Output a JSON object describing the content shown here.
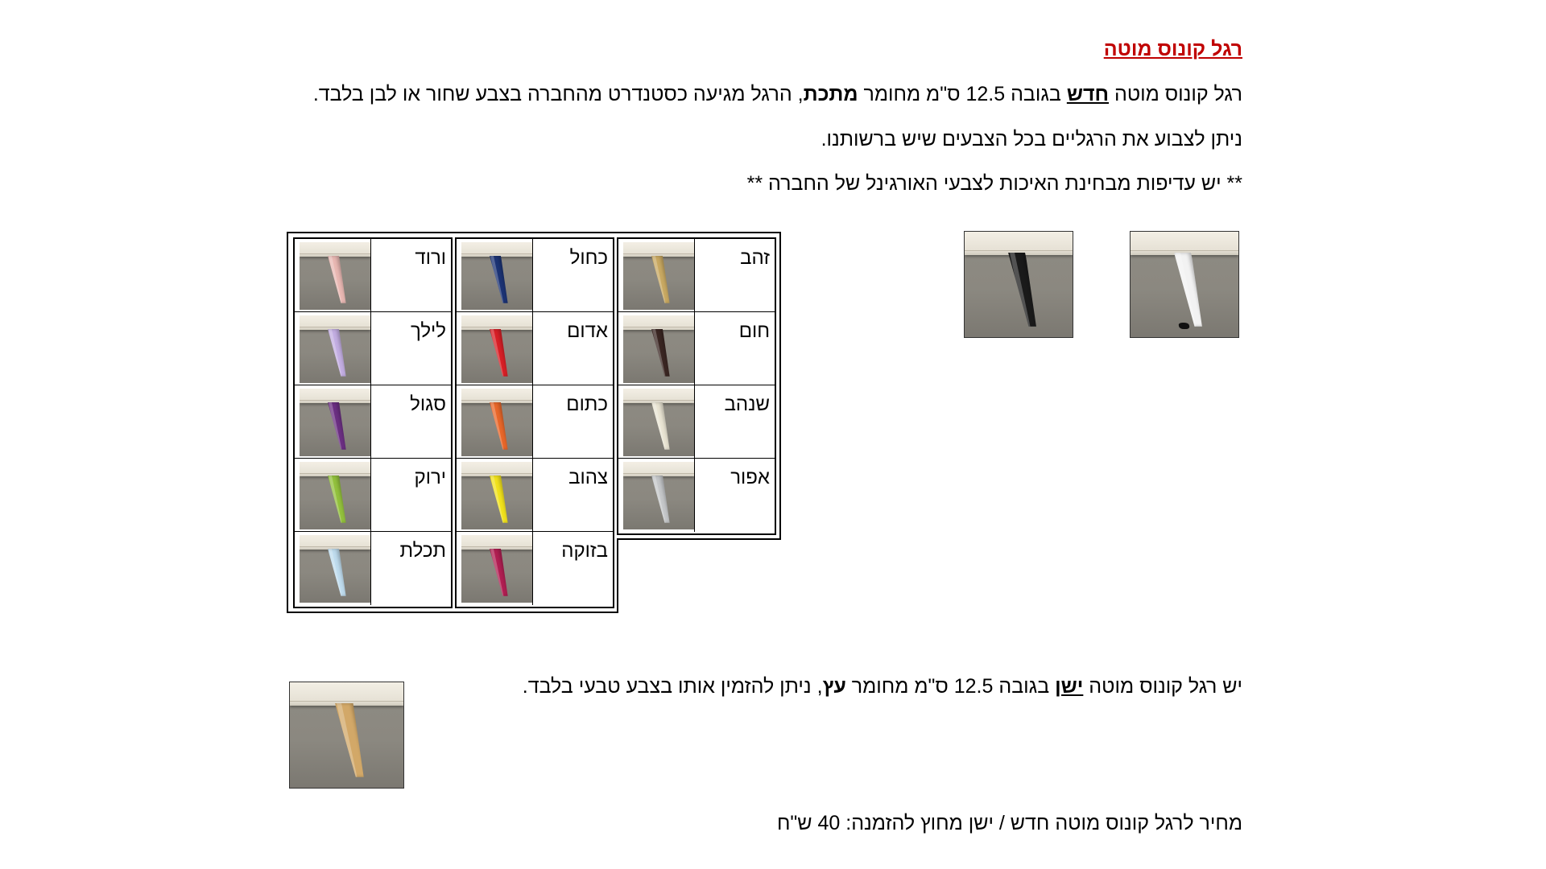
{
  "title": "רגל קונוס מוטה",
  "paragraph1": {
    "part1": "רגל קונוס מוטה ",
    "new_word": "חדש",
    "part2": " בגובה 12.5 ס\"מ מחומר ",
    "material": "מתכת",
    "part3": ", הרגל מגיעה כסטנדרט מהחברה בצבע שחור או לבן בלבד."
  },
  "paragraph2": "ניתן לצבוע את הרגליים בכל הצבעים שיש ברשותנו.",
  "paragraph3": "** יש עדיפות מבחינת האיכות לצבעי האורגינל של החברה **",
  "standard_colors": [
    {
      "color": "black",
      "leg": "#1a1a1a"
    },
    {
      "color": "white",
      "leg": "#f2f2f2"
    }
  ],
  "color_table": {
    "column1": [
      {
        "name": "זהב",
        "leg": "#c9a962"
      },
      {
        "name": "חום",
        "leg": "#3a2622"
      },
      {
        "name": "שנהב",
        "leg": "#e9e4d3"
      },
      {
        "name": "אפור",
        "leg": "#c5c7c9"
      }
    ],
    "column2": [
      {
        "name": "כחול",
        "leg": "#1c3374"
      },
      {
        "name": "אדום",
        "leg": "#d71f26"
      },
      {
        "name": "כתום",
        "leg": "#e8672a"
      },
      {
        "name": "צהוב",
        "leg": "#f1e21c"
      },
      {
        "name": "בזוקה",
        "leg": "#b01e52"
      }
    ],
    "column3": [
      {
        "name": "ורוד",
        "leg": "#e9b8b3"
      },
      {
        "name": "לילך",
        "leg": "#c3aee2"
      },
      {
        "name": "סגול",
        "leg": "#6b2f82"
      },
      {
        "name": "ירוק",
        "leg": "#93c13d"
      },
      {
        "name": "תכלת",
        "leg": "#bfdcee"
      }
    ]
  },
  "paragraph4": {
    "part1": "יש רגל קונוס מוטה ",
    "old_word": "ישן",
    "part2": " בגובה 12.5 ס\"מ מחומר ",
    "material": "עץ",
    "part3": ", ניתן להזמין אותו בצבע טבעי בלבד."
  },
  "wood_leg": {
    "leg": "#d2a868"
  },
  "price_line": "מחיר לרגל קונוס מוטה חדש / ישן מחוץ להזמנה: 40 ש\"ח"
}
